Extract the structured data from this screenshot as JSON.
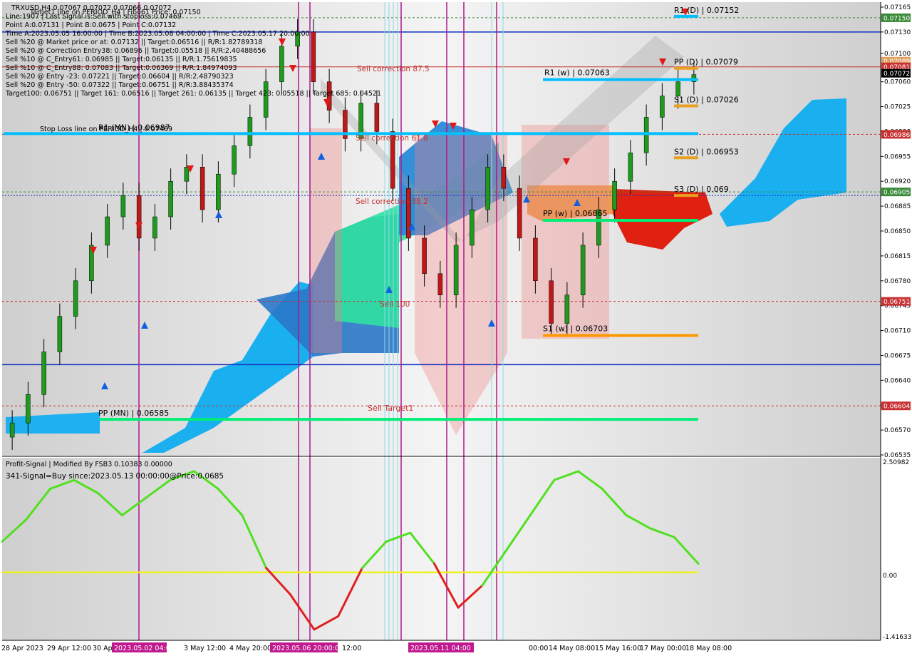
{
  "header": {
    "symbol_line": "TRXUSD,H4  0.07067 0.07072 0.07066 0.07072",
    "info_lines": [
      "Target1 line on PERIOD_H4 | Fibo61 Price: 0.07150",
      "Line:1907 | Last Signal is:Sell with stoploss:0.07469",
      "Point A:0.07131 | Point B:0.0675 | Point C:0.07132",
      "Time A:2023.05.05 16:00:00 | Time B:2023.05.08 04:00:00 | Time C:2023.05.17 20:00:00",
      "Sell %20 @ Market price or at: 0.07132 || Target:0.06516 || R/R:1.82789318",
      "Sell %20 @ Correction Entry38: 0.06896 || Target:0.05518 || R/R:2.40488656",
      "Sell %10 @ C_Entry61: 0.06985 || Target:0.06135 || R/R:1.75619835",
      "Sell %10 @ C_Entry88: 0.07083 || Target:0.06369 || R/R:1.84974093",
      "Sell %20 @ Entry -23: 0.07221 || Target:0.06604 || R/R:2.48790323",
      "Sell %20 @ Entry -50: 0.07322 || Target:0.06751 || R/R:3.88435374",
      "Target100: 0.06751 || Target 161: 0.06516 || Target 261: 0.06135 || Target 423: 0.05518 || Target 685: 0.04521"
    ],
    "stop_loss_label": "Stop Loss line on PERIOD_H4 | 0.07469",
    "target_line_overlay": "Target1 line on PERIOD_H4 | Fibo61"
  },
  "price_axis": {
    "ticks": [
      "0.07165",
      "0.07130",
      "0.07100",
      "0.07060",
      "0.07025",
      "0.06990",
      "0.06955",
      "0.06920",
      "0.06885",
      "0.06850",
      "0.06815",
      "0.06780",
      "0.06745",
      "0.06710",
      "0.06675",
      "0.06640",
      "0.06605",
      "0.06570",
      "0.06535"
    ],
    "badges": [
      {
        "text": "0.07150",
        "color": "#3a8a3a",
        "value": 0.0715
      },
      {
        "text": "0.07089",
        "color": "#e0a060",
        "value": 0.07089
      },
      {
        "text": "0.07081",
        "color": "#c83030",
        "value": 0.07081
      },
      {
        "text": "0.07072",
        "color": "#000000",
        "value": 0.07072
      },
      {
        "text": "0.06986",
        "color": "#c83030",
        "value": 0.06986
      },
      {
        "text": "0.06905",
        "color": "#3a8a3a",
        "value": 0.06905
      },
      {
        "text": "0.06751",
        "color": "#c83030",
        "value": 0.06751
      },
      {
        "text": "0.06604",
        "color": "#c83030",
        "value": 0.06604
      }
    ]
  },
  "pivots": [
    {
      "label": "R1 (D) | 0.07152",
      "value": 0.07152,
      "color": "#00bfff"
    },
    {
      "label": "PP (D) | 0.07079",
      "value": 0.07079,
      "color": "#e8a020"
    },
    {
      "label": "R1 (w) | 0.07063",
      "value": 0.07063,
      "color": "#00bfff"
    },
    {
      "label": "S1 (D) | 0.07026",
      "value": 0.07026,
      "color": "#e8a020"
    },
    {
      "label": "R1 (MN) | 0.06987",
      "value": 0.06987,
      "color": "#00bfff"
    },
    {
      "label": "S2 (D) | 0.06953",
      "value": 0.06953,
      "color": "#e8a020"
    },
    {
      "label": "S3 (D) | 0.069",
      "value": 0.069,
      "color": "#e8a020"
    },
    {
      "label": "PP (w) | 0.06865",
      "value": 0.06865,
      "color": "#00ee77"
    },
    {
      "label": "S1 (w) | 0.06703",
      "value": 0.06703,
      "color": "#ff9900"
    },
    {
      "label": "PP (MN) | 0.06585",
      "value": 0.06585,
      "color": "#00ee77"
    }
  ],
  "fib_labels": [
    "Sell correction 87.5",
    "Sell correction 61.8",
    "Sell correction 38.2",
    "Sell 100",
    "Sell Target1"
  ],
  "indicator": {
    "title": "Profit-Signal | Modified By FSB3 0.10383 0.00000",
    "signal_text": "341-Signal=Buy since:2023.05.13 00:00:00@Price:0.0685",
    "axis_ticks": [
      "2.50982",
      "0.00",
      "-1.41633"
    ]
  },
  "time_axis": {
    "labels": [
      "28 Apr 2023",
      "29 Apr 12:00",
      "30 Apr",
      "3 May 12:00",
      "4 May 20:00",
      "12:00",
      "00:00",
      "14 May 08:00",
      "15 May 16:00",
      "17 May 00:00",
      "18 May 08:00"
    ],
    "highlights": [
      {
        "text": "2023.05.02 04:00",
        "color": "#c0198f"
      },
      {
        "text": "2023.05.06 20:00:00",
        "color": "#c0198f"
      },
      {
        "text": "2023.05.11 04:00",
        "color": "#c0198f"
      }
    ]
  },
  "chart_data": {
    "type": "candlestick",
    "symbol": "TRXUSD",
    "timeframe": "H4",
    "ylim": [
      0.06535,
      0.07172
    ],
    "last_price": 0.07072,
    "candles_close": [
      0.0658,
      0.0662,
      0.0668,
      0.0673,
      0.0678,
      0.0683,
      0.0687,
      0.069,
      0.0684,
      0.0687,
      0.0692,
      0.0694,
      0.0688,
      0.0693,
      0.0697,
      0.0701,
      0.0706,
      0.0711,
      0.0713,
      0.0706,
      0.0702,
      0.0698,
      0.0703,
      0.0699,
      0.0691,
      0.0684,
      0.0679,
      0.0676,
      0.0683,
      0.0688,
      0.0694,
      0.0691,
      0.0684,
      0.0678,
      0.0672,
      0.0676,
      0.0683,
      0.0688,
      0.0692,
      0.0696,
      0.0701,
      0.0704,
      0.0706,
      0.0707
    ],
    "indicator_values": [
      0.7,
      1.2,
      1.9,
      2.1,
      1.8,
      1.3,
      1.7,
      2.1,
      2.3,
      1.9,
      1.3,
      0.1,
      -0.5,
      -1.3,
      -1.0,
      0.1,
      0.7,
      0.9,
      0.2,
      -0.8,
      -0.3,
      0.5,
      1.3,
      2.1,
      2.3,
      1.9,
      1.3,
      1.0,
      0.8,
      0.2
    ],
    "indicator_ylim": [
      -1.41633,
      2.50982
    ]
  }
}
